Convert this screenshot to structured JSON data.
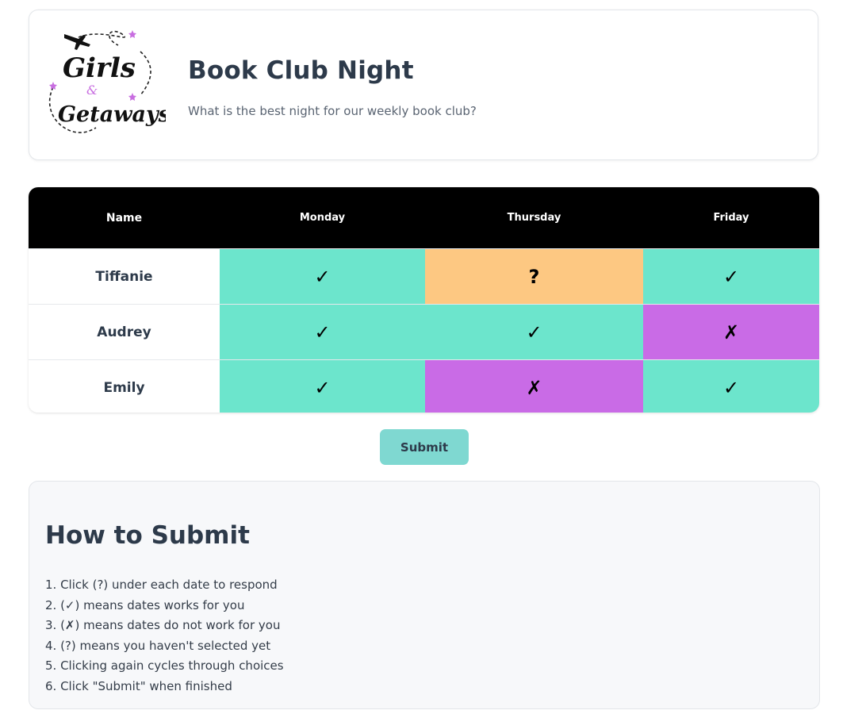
{
  "header": {
    "logo_text": "Girls & Getaways",
    "title": "Book Club Night",
    "subtitle": "What is the best night for our weekly book club?"
  },
  "table": {
    "headers": [
      "Name",
      "Monday",
      "Thursday",
      "Friday"
    ],
    "rows": [
      {
        "name": "Tiffanie",
        "cells": [
          {
            "symbol": "✓",
            "status": "yes"
          },
          {
            "symbol": "?",
            "status": "maybe"
          },
          {
            "symbol": "✓",
            "status": "yes"
          }
        ]
      },
      {
        "name": "Audrey",
        "cells": [
          {
            "symbol": "✓",
            "status": "yes"
          },
          {
            "symbol": "✓",
            "status": "yes"
          },
          {
            "symbol": "✗",
            "status": "no"
          }
        ]
      },
      {
        "name": "Emily",
        "cells": [
          {
            "symbol": "✓",
            "status": "yes"
          },
          {
            "symbol": "✗",
            "status": "no"
          },
          {
            "symbol": "✓",
            "status": "yes"
          }
        ]
      }
    ]
  },
  "submit_label": "Submit",
  "help": {
    "title": "How to Submit",
    "steps": [
      "1. Click (?) under each date to respond",
      "2. (✓) means dates works for you",
      "3. (✗) means dates do not work for you",
      "4. (?) means you haven't selected yet",
      "5. Clicking again cycles through choices",
      "6. Click \"Submit\" when finished"
    ]
  },
  "colors": {
    "yes": "#6ce5cc",
    "no": "#c96be6",
    "maybe": "#fdc882",
    "header_bg": "#000000",
    "button": "#7fd8d1",
    "logo_accent": "#c86ee0"
  }
}
